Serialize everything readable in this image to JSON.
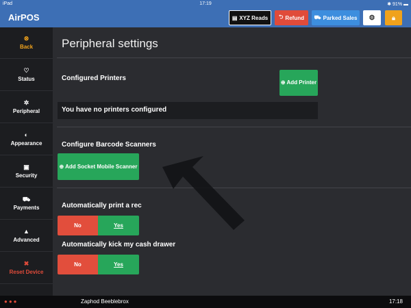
{
  "status_bar": {
    "device": "iPad",
    "time": "17:19",
    "battery": "91%"
  },
  "app": {
    "title": "AirPOS"
  },
  "toolbar": {
    "xyz_label": "XYZ Reads",
    "refund_label": "Refund",
    "parked_label": "Parked Sales"
  },
  "sidebar": {
    "items": [
      {
        "label": "Back"
      },
      {
        "label": "Status"
      },
      {
        "label": "Peripheral"
      },
      {
        "label": "Appearance"
      },
      {
        "label": "Security"
      },
      {
        "label": "Payments"
      },
      {
        "label": "Advanced"
      },
      {
        "label": "Reset Device"
      }
    ]
  },
  "main": {
    "title": "Peripheral settings",
    "printers": {
      "title": "Configured Printers",
      "add_button": "Add Printer",
      "empty_message": "You have no printers configured"
    },
    "scanners": {
      "title": "Configure Barcode Scanners",
      "add_button": "Add Socket Mobile Scanner"
    },
    "auto_print": {
      "title": "Automatically print a rec",
      "no": "No",
      "yes": "Yes",
      "selected": "Yes"
    },
    "auto_kick": {
      "title": "Automatically kick my cash drawer",
      "no": "No",
      "yes": "Yes",
      "selected": "Yes"
    }
  },
  "footer": {
    "user": "Zaphod Beeblebrox",
    "time": "17:18"
  },
  "colors": {
    "brand": "#3d6fb5",
    "green": "#27a65a",
    "red": "#e04b3a",
    "orange": "#f0a21c"
  }
}
